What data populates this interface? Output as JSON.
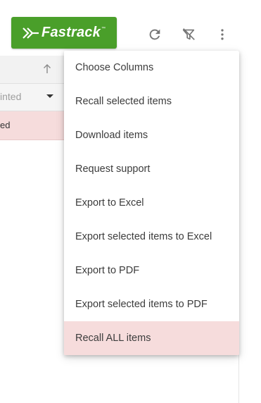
{
  "brand": {
    "name": "Fastrack",
    "trademark": "™",
    "color": "#4a9f2a"
  },
  "toolbar": {
    "icons": [
      "refresh-icon",
      "filter-off-icon",
      "more-vert-icon"
    ]
  },
  "grid": {
    "filter_value_partial": "inted",
    "row_value_partial": "ed",
    "highlight_color": "#f6dcdc"
  },
  "menu": {
    "items": [
      {
        "label": "Choose Columns"
      },
      {
        "label": "Recall selected items"
      },
      {
        "label": "Download items"
      },
      {
        "label": "Request support"
      },
      {
        "label": "Export to Excel"
      },
      {
        "label": "Export selected items to Excel"
      },
      {
        "label": "Export to PDF"
      },
      {
        "label": "Export selected items to PDF"
      },
      {
        "label": "Recall ALL items",
        "active": true
      }
    ]
  }
}
